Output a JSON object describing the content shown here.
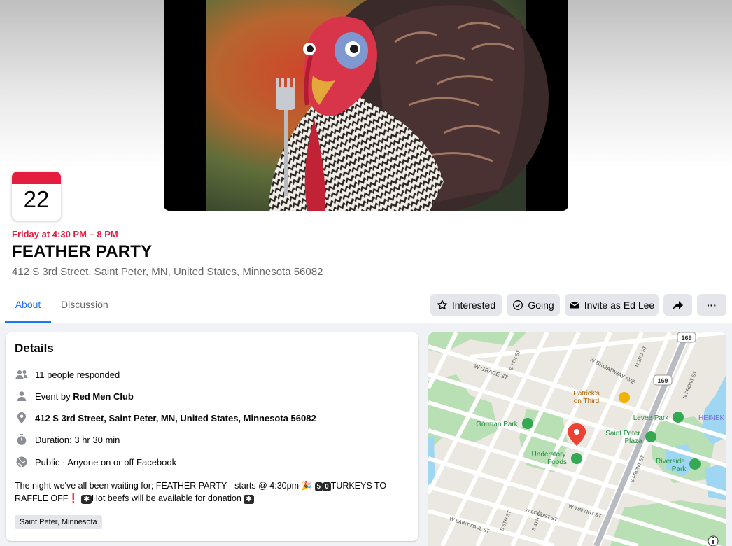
{
  "event": {
    "date_day": "22",
    "when": "Friday at 4:30 PM – 8 PM",
    "title": "FEATHER PARTY",
    "address": "412 S 3rd Street, Saint Peter, MN, United States, Minnesota 56082"
  },
  "tabs": [
    {
      "label": "About",
      "active": true
    },
    {
      "label": "Discussion",
      "active": false
    }
  ],
  "actions": {
    "interested": "Interested",
    "going": "Going",
    "invite": "Invite as Ed Lee",
    "more": "···"
  },
  "details": {
    "heading": "Details",
    "responded": "11 people responded",
    "event_by_prefix": "Event by ",
    "host": "Red Men Club",
    "address": "412 S 3rd Street, Saint Peter, MN, United States, Minnesota 56082",
    "duration": "Duration: 3 hr 30 min",
    "privacy": "Public · Anyone on or off Facebook",
    "desc_1": "The night we've all been waiting for; FEATHER PARTY - starts @ 4:30pm",
    "desc_2": "TURKEYS TO",
    "desc_3": "RAFFLE OFF",
    "desc_4": "Hot beefs will be available for donation",
    "keycap_5": "5",
    "keycap_0": "0",
    "tag": "Saint Peter, Minnesota"
  },
  "map": {
    "labels": {
      "broadway": "W BROADWAY AVE",
      "grace": "W GRACE ST",
      "patricks_1": "Patrick's",
      "patricks_2": "on Third",
      "gorman": "Gorman Park",
      "levee": "Levee Park",
      "heinek": "HEINEK",
      "saint_peter_plaza_1": "Saint Peter",
      "saint_peter_plaza_2": "Plaza",
      "understory_1": "Understory",
      "understory_2": "Foods",
      "riverside_1": "Riverside",
      "riverside_2": "Park",
      "hwy_169_a": "169",
      "hwy_169_b": "169",
      "saint_paul": "W SAINT PAUL ST",
      "locust": "W LOCUST ST",
      "walnut": "W WALNUT ST",
      "front": "S FRONT ST",
      "n_front": "N FRONT ST",
      "st5": "S 5TH ST",
      "st4": "S 4TH ST",
      "n3rd": "N 3RD ST",
      "s7": "S 7TH ST"
    },
    "colors": {
      "park": "#b9dfb5",
      "water": "#9fd6f1",
      "pin": "#ea4335",
      "poi_green": "#34a853"
    }
  }
}
